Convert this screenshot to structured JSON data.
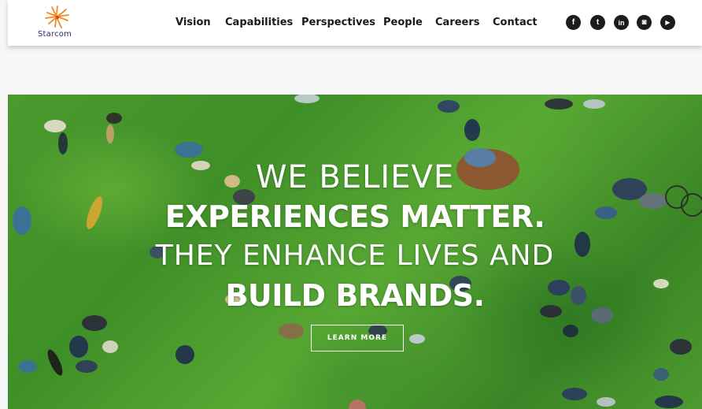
{
  "header": {
    "logo_text": "Starcom",
    "nav": [
      {
        "label": "Vision",
        "id": "vision"
      },
      {
        "label": "Capabilities",
        "id": "capabilities"
      },
      {
        "label": "Perspectives",
        "id": "perspectives"
      },
      {
        "label": "People",
        "id": "people"
      },
      {
        "label": "Careers",
        "id": "careers"
      },
      {
        "label": "Contact",
        "id": "contact"
      }
    ],
    "social": [
      {
        "icon": "facebook-icon",
        "glyph": "f"
      },
      {
        "icon": "twitter-icon",
        "glyph": "t"
      },
      {
        "icon": "linkedin-icon",
        "glyph": "in"
      },
      {
        "icon": "instagram-icon",
        "glyph": "◙"
      },
      {
        "icon": "youtube-icon",
        "glyph": "▶"
      }
    ]
  },
  "hero": {
    "line1": "WE BELIEVE",
    "line2": "EXPERIENCES MATTER.",
    "line3": "THEY ENHANCE LIVES AND",
    "line4": "BUILD BRANDS.",
    "button_label": "LEARN MORE"
  },
  "colors": {
    "grass": "#4a9a2e",
    "logo_accent": "#f08a24",
    "nav_text": "#1a1a1a"
  }
}
